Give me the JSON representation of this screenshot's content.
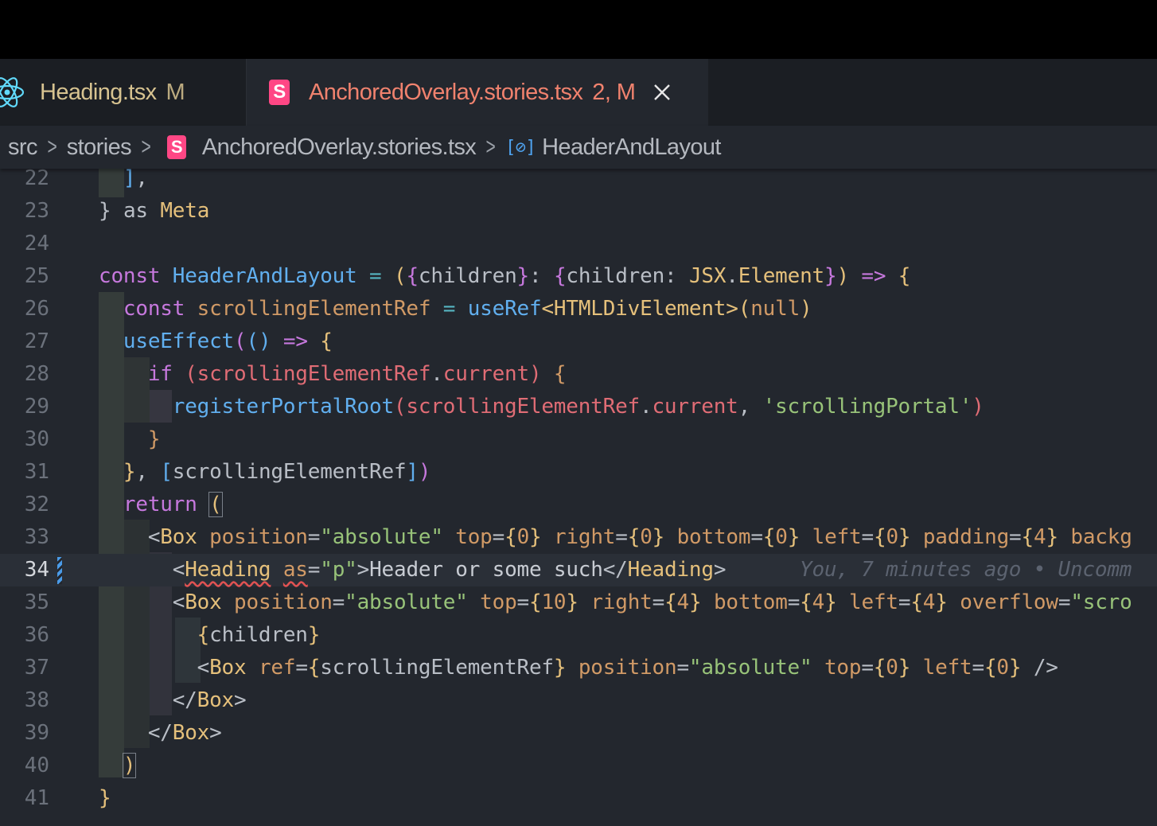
{
  "tabs": [
    {
      "name": "Heading.tsx",
      "badge": "M",
      "icon": "react-icon"
    },
    {
      "name": "AnchoredOverlay.stories.tsx",
      "badge": "2, M",
      "icon": "storybook-icon",
      "active": true
    }
  ],
  "breadcrumb": {
    "items": [
      "src",
      "stories",
      "AnchoredOverlay.stories.tsx",
      "HeaderAndLayout"
    ],
    "separator": ">"
  },
  "editor": {
    "active_line": 34,
    "blame": "You, 7 minutes ago • Uncomm",
    "lines": [
      {
        "n": "22"
      },
      {
        "n": "23"
      },
      {
        "n": "24"
      },
      {
        "n": "25"
      },
      {
        "n": "26"
      },
      {
        "n": "27"
      },
      {
        "n": "28"
      },
      {
        "n": "29"
      },
      {
        "n": "30"
      },
      {
        "n": "31"
      },
      {
        "n": "32"
      },
      {
        "n": "33"
      },
      {
        "n": "34"
      },
      {
        "n": "35"
      },
      {
        "n": "36"
      },
      {
        "n": "37"
      },
      {
        "n": "38"
      },
      {
        "n": "39"
      },
      {
        "n": "40"
      },
      {
        "n": "41"
      }
    ]
  },
  "colors": {
    "keyword": "#c678dd",
    "function": "#61afef",
    "type": "#e5c07b",
    "string": "#98c379",
    "attribute": "#d19a66",
    "storybook": "#ff4785"
  }
}
